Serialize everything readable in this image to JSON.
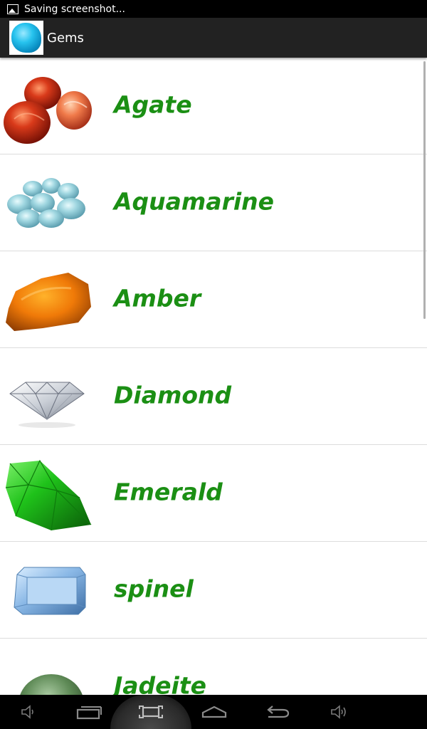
{
  "status_bar": {
    "notification_icon": "image-icon",
    "text": "Saving screenshot..."
  },
  "action_bar": {
    "app_icon": "blue-gem-icon",
    "title": "Gems"
  },
  "gems": [
    {
      "name": "Agate",
      "image": "agate-stones"
    },
    {
      "name": "Aquamarine",
      "image": "aquamarine-stones"
    },
    {
      "name": "Amber",
      "image": "amber-stone"
    },
    {
      "name": "Diamond",
      "image": "diamond-cut"
    },
    {
      "name": "Emerald",
      "image": "emerald-cut"
    },
    {
      "name": "spinel",
      "image": "spinel-emerald-cut"
    },
    {
      "name": "Jadeite",
      "image": "jadeite-stone"
    }
  ],
  "nav_bar": {
    "buttons": [
      "volume-down-icon",
      "recent-apps-icon",
      "screenshot-icon",
      "home-icon",
      "back-icon",
      "volume-up-icon"
    ]
  },
  "colors": {
    "gem_label": "#1b8f14",
    "action_bar": "#222222",
    "status_bar": "#000000",
    "nav_bar": "#000000"
  }
}
